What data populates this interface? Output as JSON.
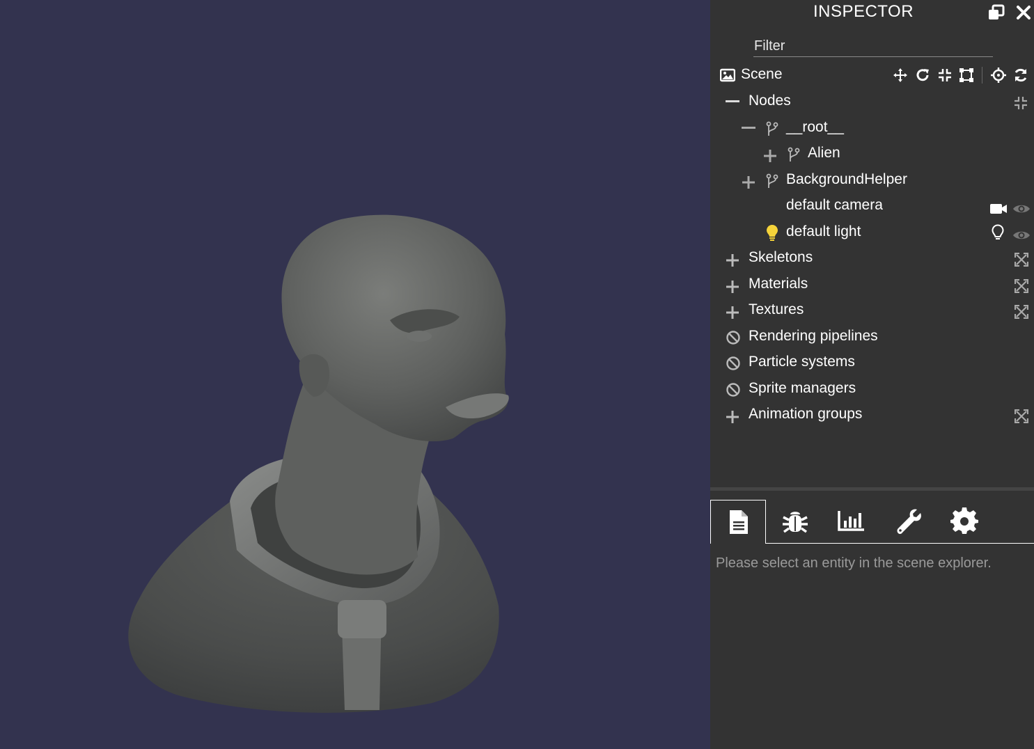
{
  "viewport": {
    "background_color": "#33334f",
    "model_color": "#6a6c6a"
  },
  "inspector": {
    "title": "INSPECTOR",
    "popout_icon": "popout-window-icon",
    "close_icon": "close-icon",
    "filter_placeholder": "Filter",
    "scene": {
      "label": "Scene",
      "icon": "image-icon",
      "tools": [
        "move-icon",
        "rotate-icon",
        "scale-icon",
        "bounding-box-icon",
        "crosshair-icon",
        "refresh-icon"
      ]
    },
    "nodes": {
      "label": "Nodes",
      "items": [
        {
          "label": "__root__",
          "expander": "minus",
          "icon": "branch-icon"
        },
        {
          "label": "Alien",
          "expander": "plus",
          "icon": "branch-icon"
        },
        {
          "label": "BackgroundHelper",
          "expander": "plus",
          "icon": "branch-icon"
        },
        {
          "label": "default camera",
          "actions": [
            "video-camera-icon",
            "eye-icon"
          ]
        },
        {
          "label": "default light",
          "icon": "lightbulb-icon",
          "actions": [
            "lightbulb-outline-icon",
            "eye-icon"
          ]
        }
      ]
    },
    "sections": [
      {
        "label": "Skeletons",
        "state": "plus"
      },
      {
        "label": "Materials",
        "state": "plus"
      },
      {
        "label": "Textures",
        "state": "plus"
      },
      {
        "label": "Rendering pipelines",
        "state": "disabled"
      },
      {
        "label": "Particle systems",
        "state": "disabled"
      },
      {
        "label": "Sprite managers",
        "state": "disabled"
      },
      {
        "label": "Animation groups",
        "state": "plus"
      }
    ],
    "tabs": [
      "document-icon",
      "bug-icon",
      "chart-icon",
      "wrench-icon",
      "gear-icon"
    ],
    "empty_message": "Please select an entity in the scene explorer.",
    "colors": {
      "panel": "#333333",
      "text": "#ffffff",
      "muted": "#9a9a9a",
      "light_icon": "#f5d33a"
    }
  }
}
